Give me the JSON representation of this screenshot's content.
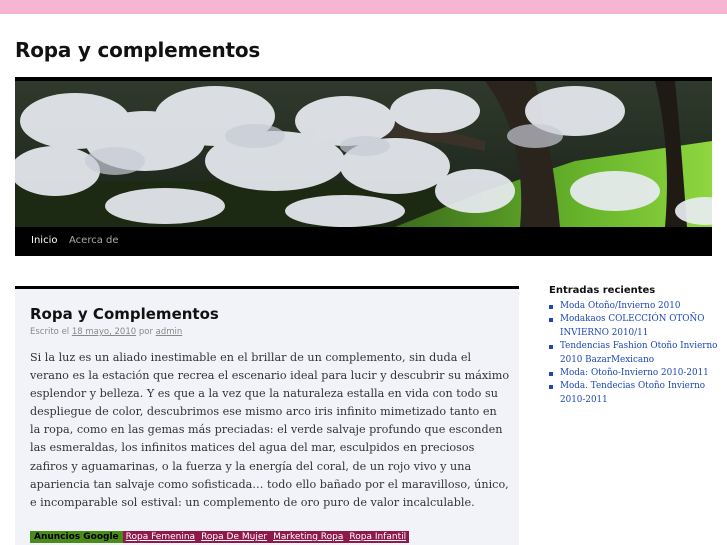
{
  "site": {
    "title": "Ropa y complementos"
  },
  "nav": {
    "items": [
      {
        "label": "Inicio",
        "active": true
      },
      {
        "label": "Acerca de",
        "active": false
      }
    ]
  },
  "post": {
    "title": "Ropa y Complementos",
    "meta": {
      "prefix": "Escrito el",
      "date": "18 mayo, 2010",
      "by": "por",
      "author": "admin"
    },
    "body": "Si la luz es un aliado inestimable en el brillar de un complemento, sin duda el verano es la estación que recrea el escenario ideal para lucir y descubrir su máximo esplendor y belleza. Y es que a la vez que la naturaleza estalla en vida con todo su despliegue de color, descubrimos ese mismo arco iris infinito mimetizado tanto en la ropa, como en las gemas más preciadas: el verde salvaje profundo que esconden las esmeraldas, los infinitos matices del agua del mar, esculpidos en preciosos zafiros y aguamarinas, o la fuerza y la energía del coral, de un rojo vivo y una apariencia tan salvaje como sofisticada… todo ello bañado por el maravilloso, único, e incomparable sol estival: un complemento de oro puro de valor incalculable."
  },
  "ads": {
    "label": "Anuncios Google",
    "links": [
      "Ropa Femenina",
      "Ropa De Mujer",
      "Marketing Ropa",
      "Ropa Infantil"
    ]
  },
  "sidebar": {
    "heading": "Entradas recientes",
    "items": [
      "Moda Otoño/Invierno 2010",
      "Modakaos COLECCIÓN OTOÑO INVIERNO 2010/11",
      "Tendencias Fashion Otoño Invierno 2010 BazarMexicano",
      "Moda: Otoño-Invierno 2010-2011",
      "Moda. Tendecias Otoño Invierno 2010-2011"
    ]
  },
  "colors": {
    "topbar": "#f6b5d3",
    "link": "#1b47b8",
    "ad_label_bg": "#4b8b1a",
    "ad_link_bg": "#8e1a4a"
  }
}
